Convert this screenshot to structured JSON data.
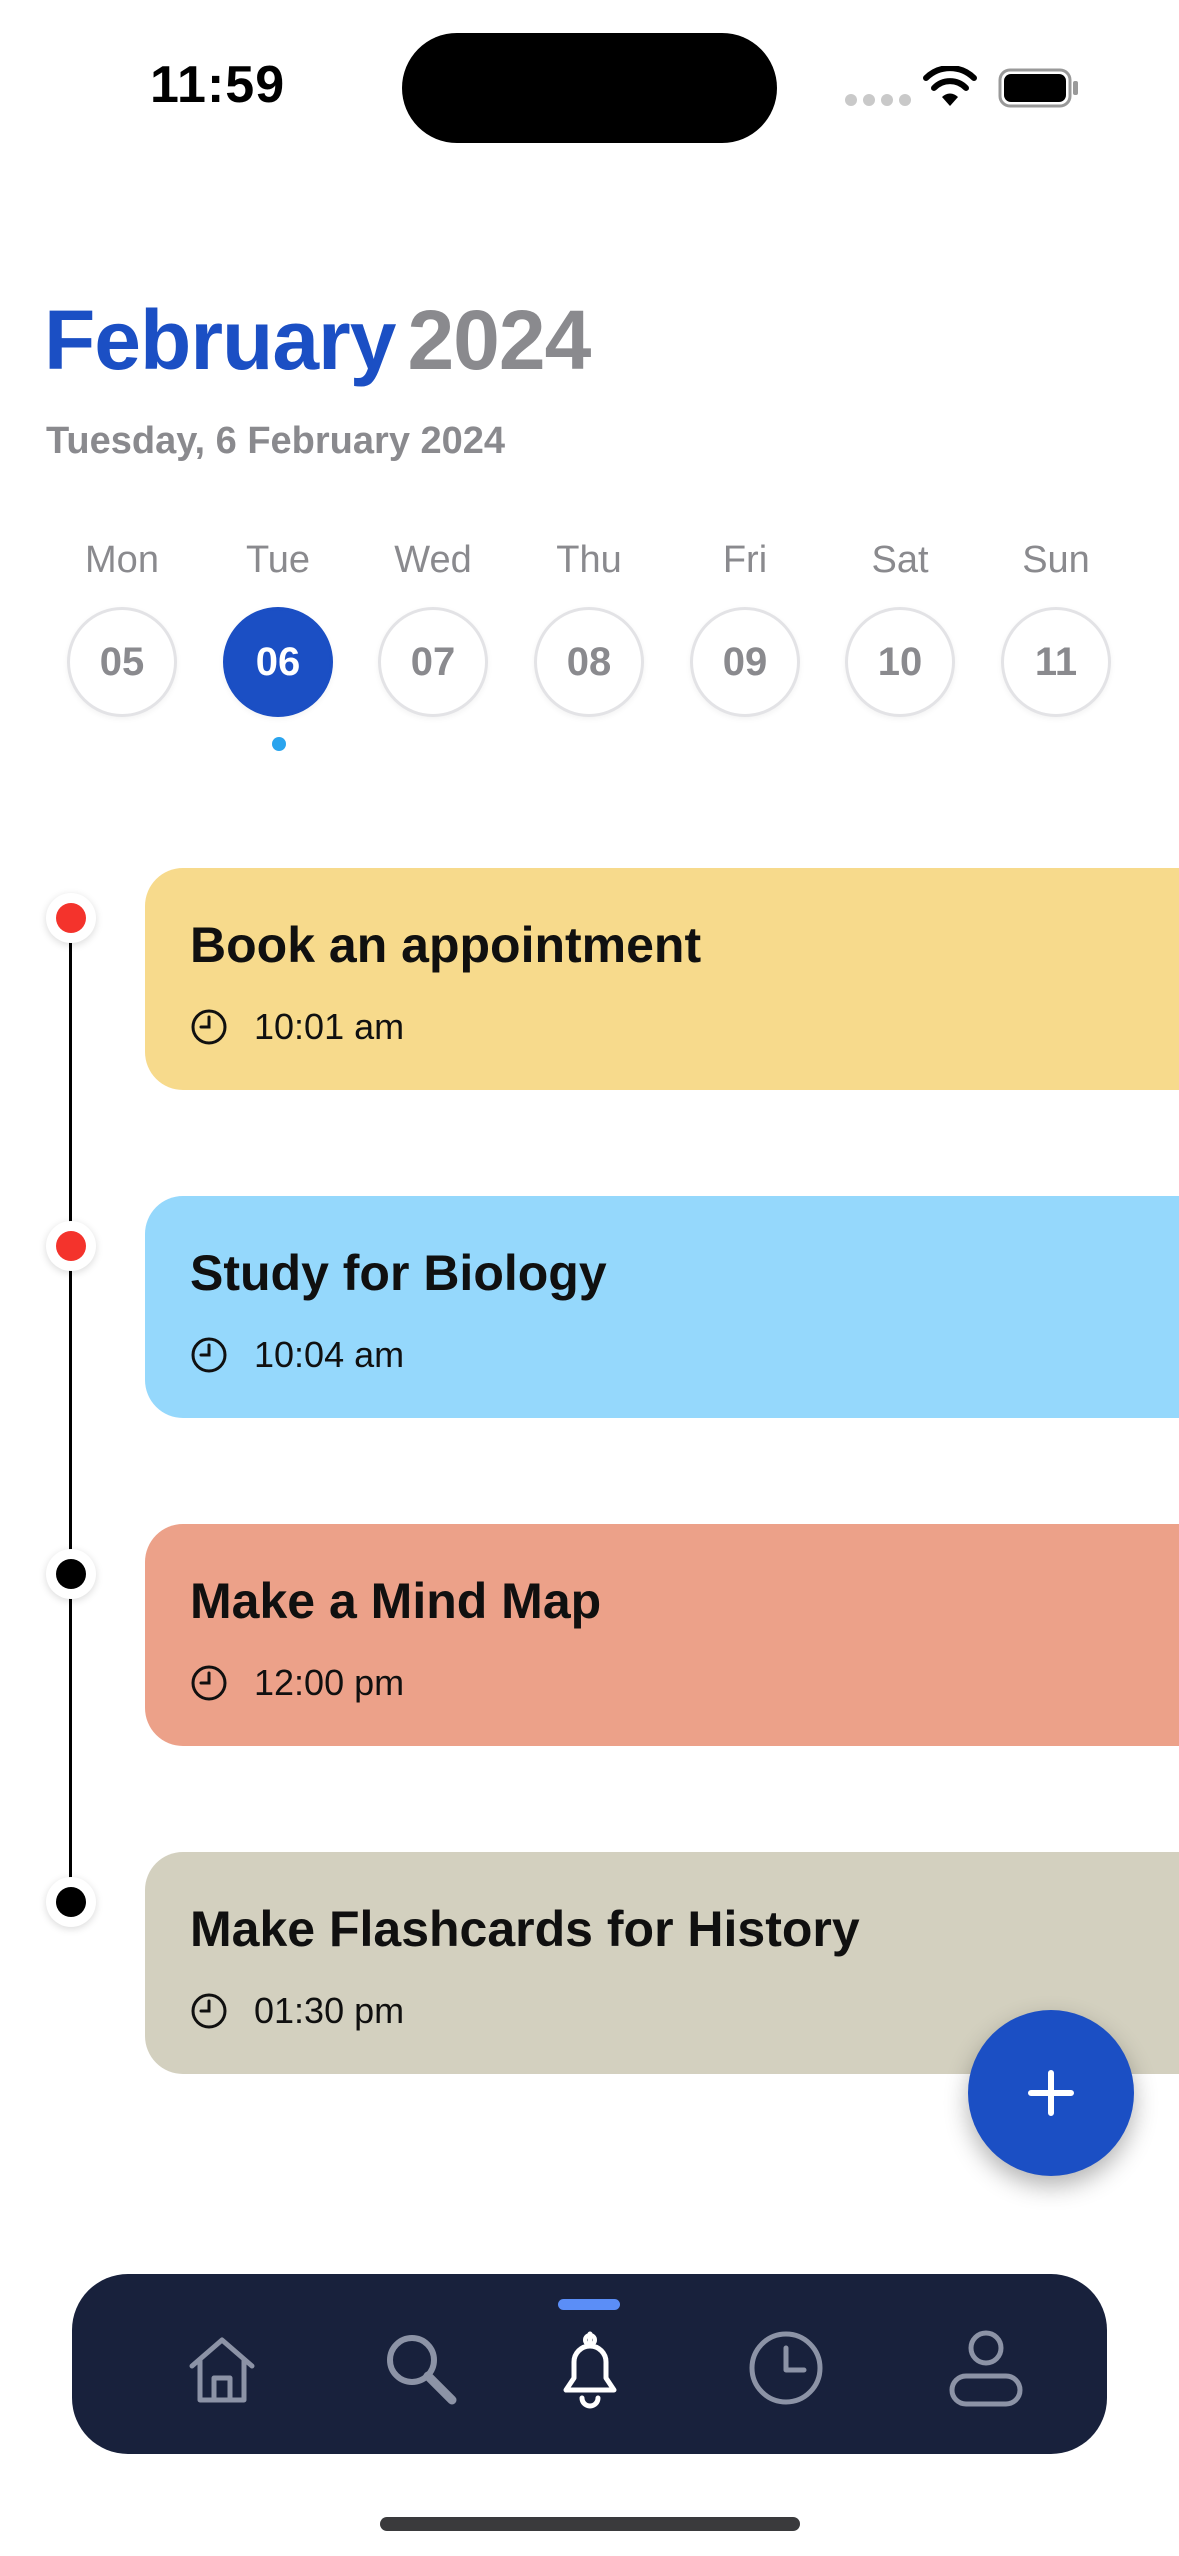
{
  "status_bar": {
    "time": "11:59"
  },
  "header": {
    "month": "February",
    "year": "2024",
    "subtitle": "Tuesday, 6 February 2024"
  },
  "week": [
    {
      "name": "Mon",
      "date": "05",
      "selected": false
    },
    {
      "name": "Tue",
      "date": "06",
      "selected": true
    },
    {
      "name": "Wed",
      "date": "07",
      "selected": false
    },
    {
      "name": "Thu",
      "date": "08",
      "selected": false
    },
    {
      "name": "Fri",
      "date": "09",
      "selected": false
    },
    {
      "name": "Sat",
      "date": "10",
      "selected": false
    },
    {
      "name": "Sun",
      "date": "11",
      "selected": false
    }
  ],
  "tasks": [
    {
      "title": "Book an appointment",
      "time": "10:01 am",
      "color": "#f7da8c",
      "marker_color": "#f4332c"
    },
    {
      "title": "Study for Biology",
      "time": "10:04 am",
      "color": "#95d8fc",
      "marker_color": "#f4332c"
    },
    {
      "title": "Make a Mind Map",
      "time": "12:00 pm",
      "color": "#eca189",
      "marker_color": "#000000"
    },
    {
      "title": "Make Flashcards for History",
      "time": "01:30 pm",
      "color": "#d3d0bf",
      "marker_color": "#000000"
    }
  ],
  "fab": {
    "icon": "plus-icon"
  },
  "bottom_nav": {
    "items": [
      {
        "icon": "home-icon",
        "active": false
      },
      {
        "icon": "search-icon",
        "active": false
      },
      {
        "icon": "bell-icon",
        "active": true
      },
      {
        "icon": "clock-icon",
        "active": false
      },
      {
        "icon": "profile-icon",
        "active": false
      }
    ]
  },
  "colors": {
    "accent": "#1b4fc4",
    "muted_text": "#8a8a8e",
    "nav_background": "#18213c",
    "nav_indicator": "#5b8ef7",
    "today_dot": "#2aa4ee"
  }
}
